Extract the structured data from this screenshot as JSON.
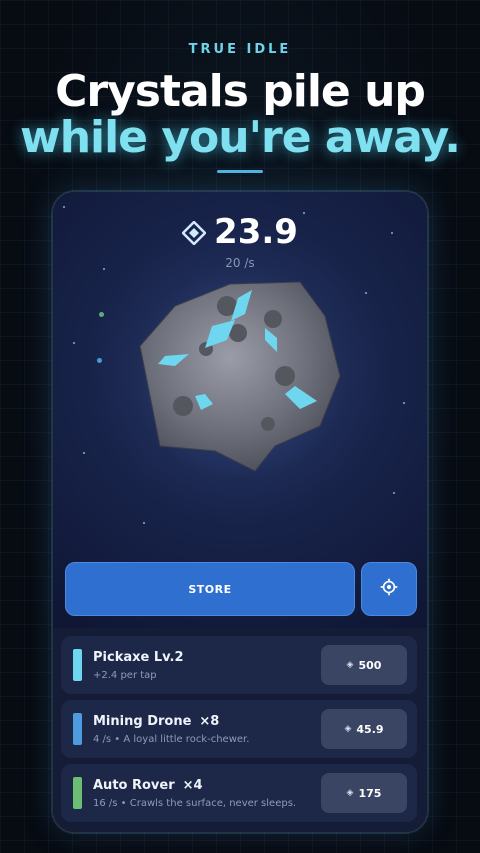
{
  "promo": {
    "eyebrow": "TRUE IDLE",
    "headline_line1": "Crystals pile up",
    "headline_line2": "while you're away."
  },
  "game": {
    "crystal_count": "23.9",
    "rate": "20 /s",
    "gem_icon": "diamond-gem-icon",
    "store_label": "STORE",
    "settings_icon": "gear-icon"
  },
  "upgrades": [
    {
      "name": "Pickaxe Lv.2",
      "count": "",
      "desc": "+2.4 per tap",
      "price": "500",
      "color": "#6fd6ef"
    },
    {
      "name": "Mining Drone",
      "count": "×8",
      "desc": "4 /s  •  A loyal little rock-chewer.",
      "price": "45.9",
      "color": "#4f9be0"
    },
    {
      "name": "Auto Rover",
      "count": "×4",
      "desc": "16 /s  •  Crawls the surface, never sleeps.",
      "price": "175",
      "color": "#6cbf72"
    }
  ],
  "colors": {
    "accent_cyan": "#7fe0f0",
    "button_blue": "#2f6fd0",
    "crystal": "#6fd6ef"
  }
}
